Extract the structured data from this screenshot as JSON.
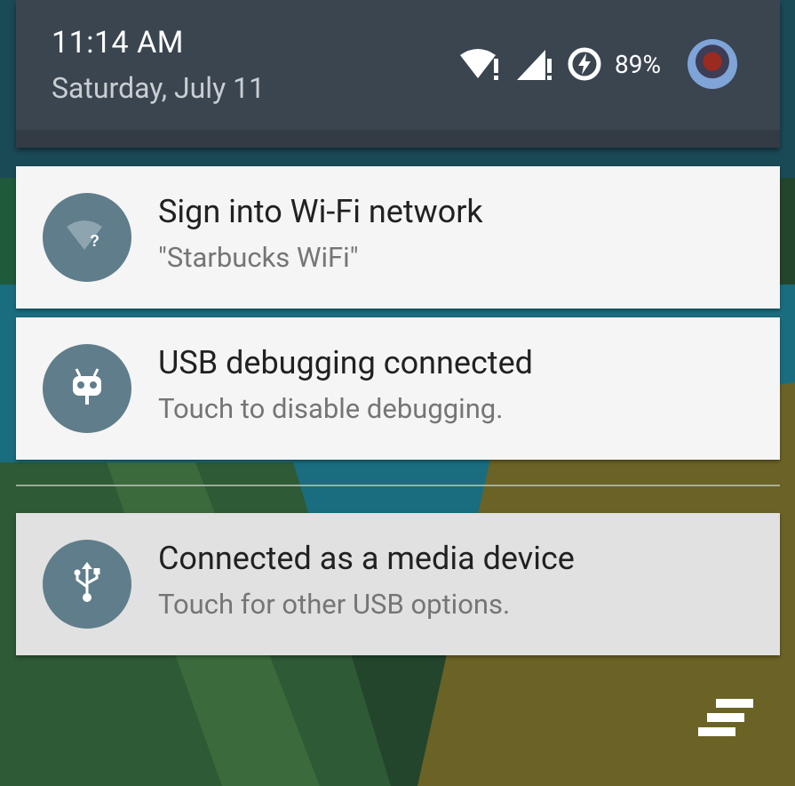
{
  "status_bar": {
    "time": "11:14 AM",
    "date": "Saturday, July 11",
    "battery_percent": "89%",
    "icons": [
      "wifi-alert-icon",
      "cell-signal-alert-icon",
      "battery-charging-icon",
      "user-avatar"
    ]
  },
  "notifications": [
    {
      "title": "Sign into Wi-Fi network",
      "subtitle": "\"Starbucks WiFi\"",
      "icon": "wifi-question-icon"
    },
    {
      "title": "USB debugging connected",
      "subtitle": "Touch to disable debugging.",
      "icon": "cyanogen-bot-icon"
    },
    {
      "title": "Connected as a media device",
      "subtitle": "Touch for other USB options.",
      "icon": "usb-icon"
    }
  ],
  "actions": {
    "clear_all_icon": "clear-all-icon"
  },
  "colors": {
    "header_bg": "#3b454f",
    "card_bg": "#f5f5f5",
    "card_bg_pressed": "#e1e1e1",
    "icon_circle": "#607d8b"
  }
}
